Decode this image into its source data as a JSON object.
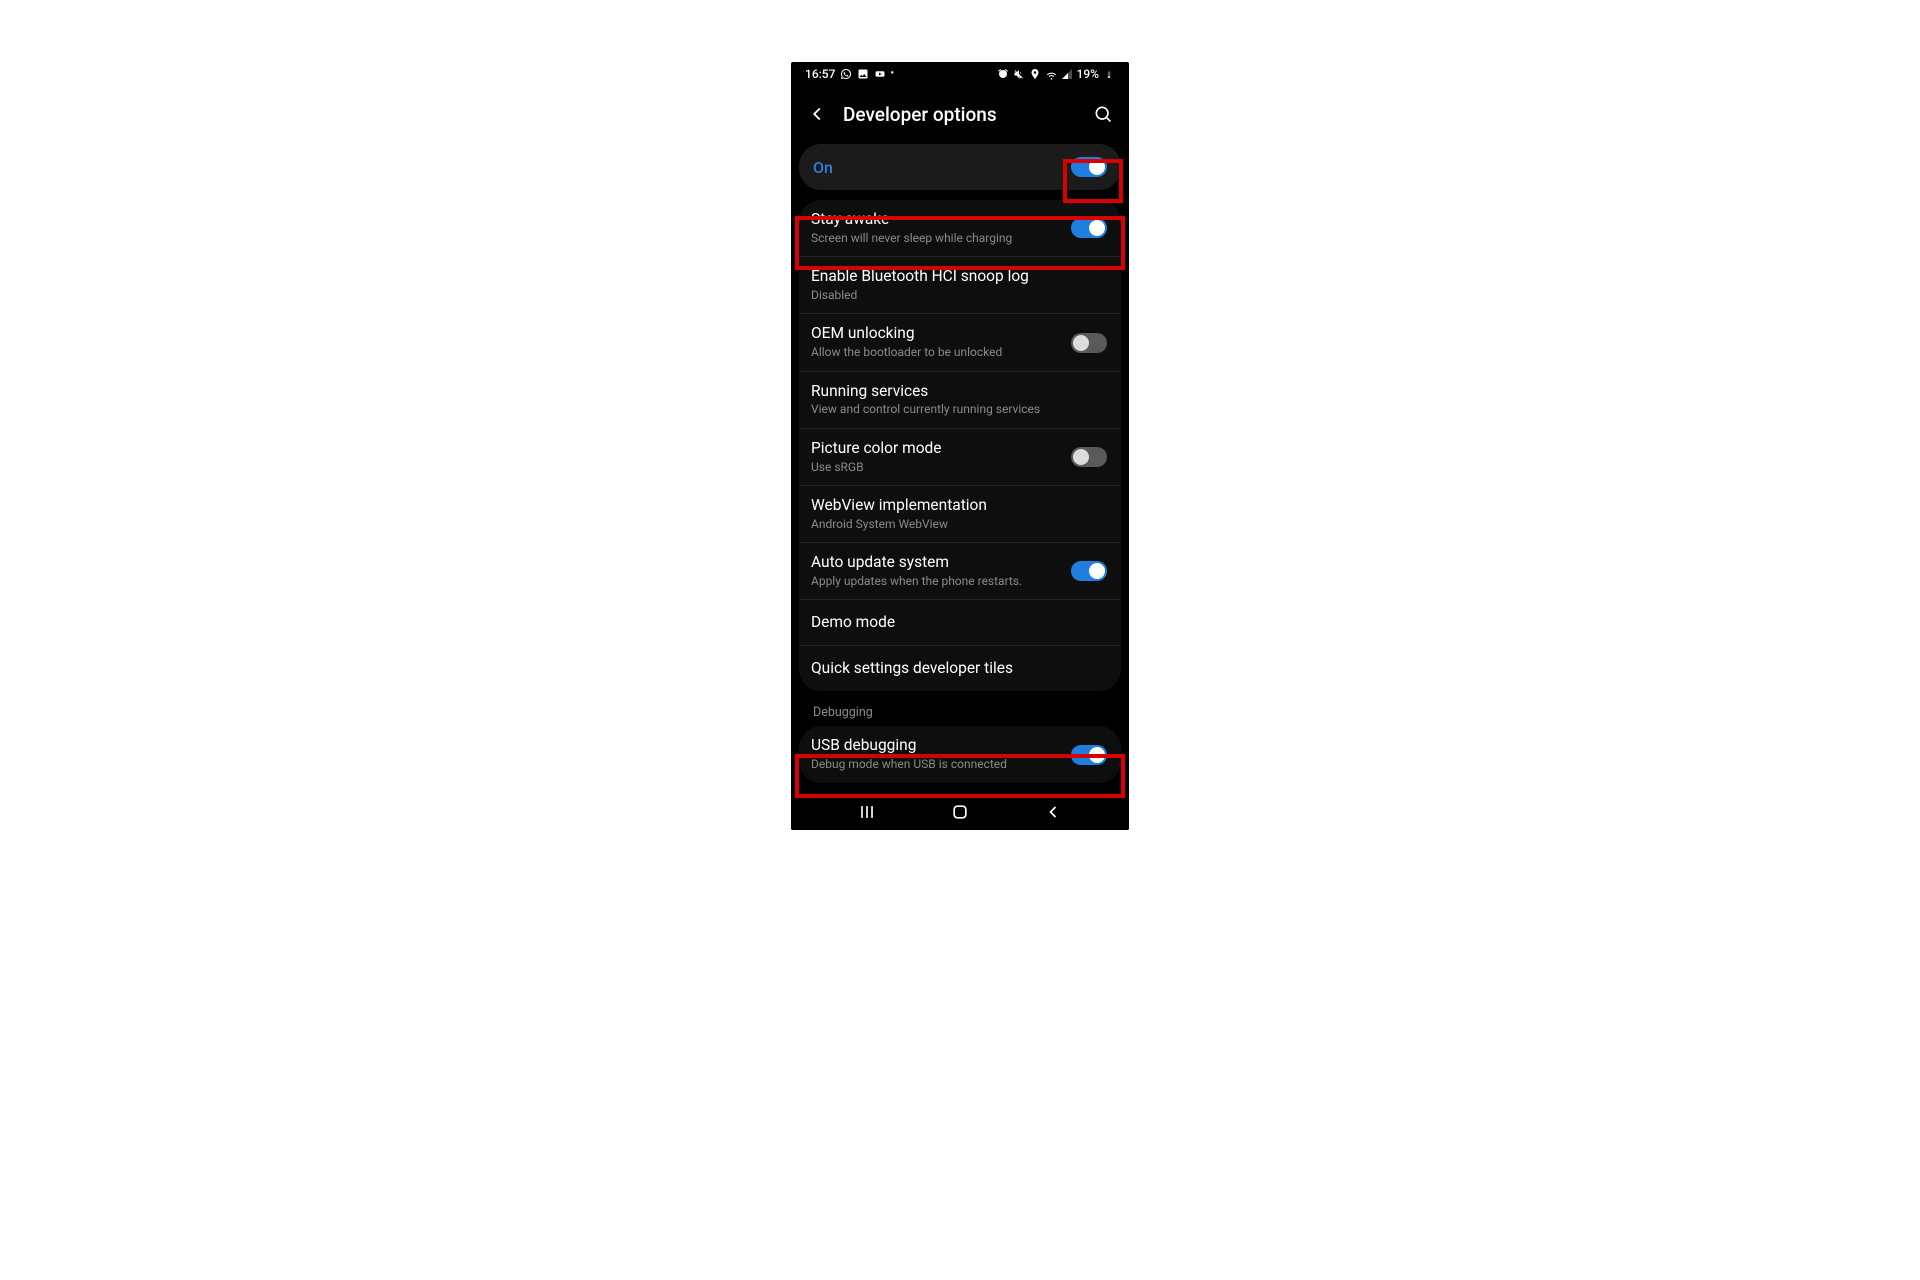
{
  "status": {
    "time": "16:57",
    "battery_pct": "19%"
  },
  "header": {
    "title": "Developer options"
  },
  "master": {
    "label": "On",
    "on": true
  },
  "rows": [
    {
      "id": "stay-awake",
      "title": "Stay awake",
      "sub": "Screen will never sleep while charging",
      "toggle": true,
      "on": true
    },
    {
      "id": "bt-hci",
      "title": "Enable Bluetooth HCI snoop log",
      "sub": "Disabled",
      "toggle": false
    },
    {
      "id": "oem-unlock",
      "title": "OEM unlocking",
      "sub": "Allow the bootloader to be unlocked",
      "toggle": true,
      "on": false
    },
    {
      "id": "running-svc",
      "title": "Running services",
      "sub": "View and control currently running services",
      "toggle": false
    },
    {
      "id": "color-mode",
      "title": "Picture color mode",
      "sub": "Use sRGB",
      "toggle": true,
      "on": false
    },
    {
      "id": "webview",
      "title": "WebView implementation",
      "sub": "Android System WebView",
      "toggle": false
    },
    {
      "id": "auto-update",
      "title": "Auto update system",
      "sub": "Apply updates when the phone restarts.",
      "toggle": true,
      "on": true
    },
    {
      "id": "demo-mode",
      "title": "Demo mode",
      "sub": "",
      "toggle": false
    },
    {
      "id": "quick-tiles",
      "title": "Quick settings developer tiles",
      "sub": "",
      "toggle": false
    }
  ],
  "section_header": "Debugging",
  "rows2": [
    {
      "id": "usb-debug",
      "title": "USB debugging",
      "sub": "Debug mode when USB is connected",
      "toggle": true,
      "on": true
    }
  ]
}
